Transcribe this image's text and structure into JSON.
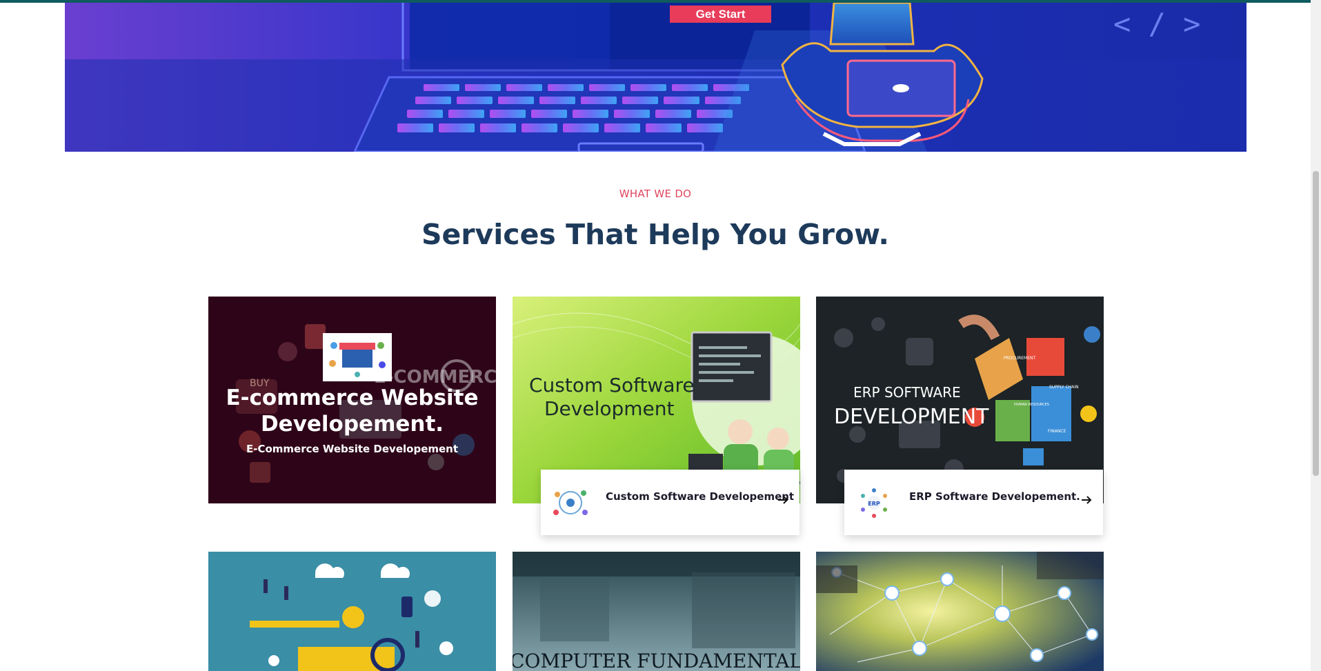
{
  "hero": {
    "cta_label": "Get Start",
    "code_glyph": "< / >"
  },
  "services": {
    "eyebrow": "WHAT WE DO",
    "title": "Services That Help You Grow.",
    "cards": [
      {
        "overlay_title": "E-commerce Website Developement.",
        "overlay_subtitle": "E-Commerce Website Developement",
        "image_text": "E-COMMERCE",
        "image_badge": "BUY"
      },
      {
        "image_text_line1": "Custom Software",
        "image_text_line2": "Development",
        "label": "Custom Software Developement"
      },
      {
        "image_text_line1": "ERP SOFTWARE",
        "image_text_line2": "DEVELOPMENT",
        "label": "ERP Software Developement.",
        "icon_text": "ERP",
        "puzzle_labels": [
          "PROCUREMENT",
          "SUPPLY CHAIN",
          "HUMAN RESOURCES",
          "FINANCE"
        ]
      },
      {
        "image": "digital-marketing-illustration"
      },
      {
        "image_text": "COMPUTER FUNDAMENTAL"
      },
      {
        "image": "network-people-illustration"
      }
    ]
  },
  "colors": {
    "accent": "#e83c5a",
    "heading": "#1d3a5a",
    "hero_purple": "#6a3fd0",
    "hero_blue": "#1c2fb6"
  }
}
